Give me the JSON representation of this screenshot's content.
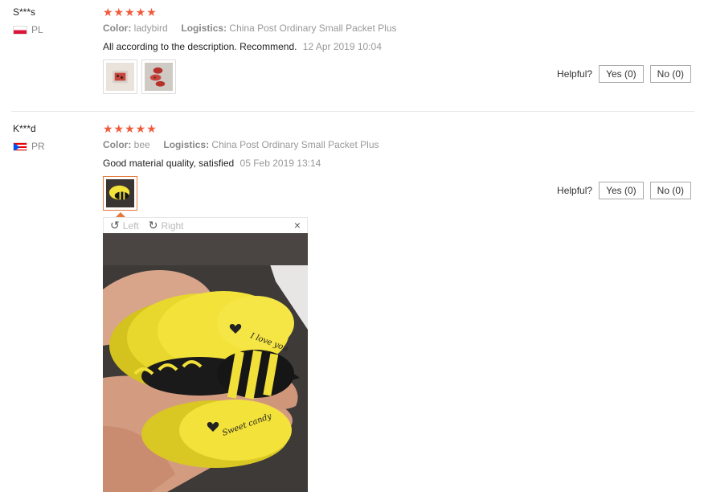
{
  "reviews": [
    {
      "user": "S***s",
      "country": "PL",
      "stars": "★★★★★",
      "color_label": "Color:",
      "color_value": "ladybird",
      "logistics_label": "Logistics:",
      "logistics_value": "China Post Ordinary Small Packet Plus",
      "text": "All according to the description. Recommend.",
      "date": "12 Apr 2019 10:04",
      "helpful_label": "Helpful?",
      "yes_label": "Yes (0)",
      "no_label": "No (0)"
    },
    {
      "user": "K***d",
      "country": "PR",
      "stars": "★★★★★",
      "color_label": "Color:",
      "color_value": "bee",
      "logistics_label": "Logistics:",
      "logistics_value": "China Post Ordinary Small Packet Plus",
      "text": "Good material quality, satisfied",
      "date": "05 Feb 2019 13:14",
      "helpful_label": "Helpful?",
      "yes_label": "Yes (0)",
      "no_label": "No (0)"
    }
  ],
  "viewer": {
    "rotate_left_label": "Left",
    "rotate_right_label": "Right",
    "rotate_left_icon": "↺",
    "rotate_right_icon": "↻",
    "close_icon": "×",
    "tag_text_top": "I love you",
    "tag_text_bottom": "Sweet candy"
  }
}
